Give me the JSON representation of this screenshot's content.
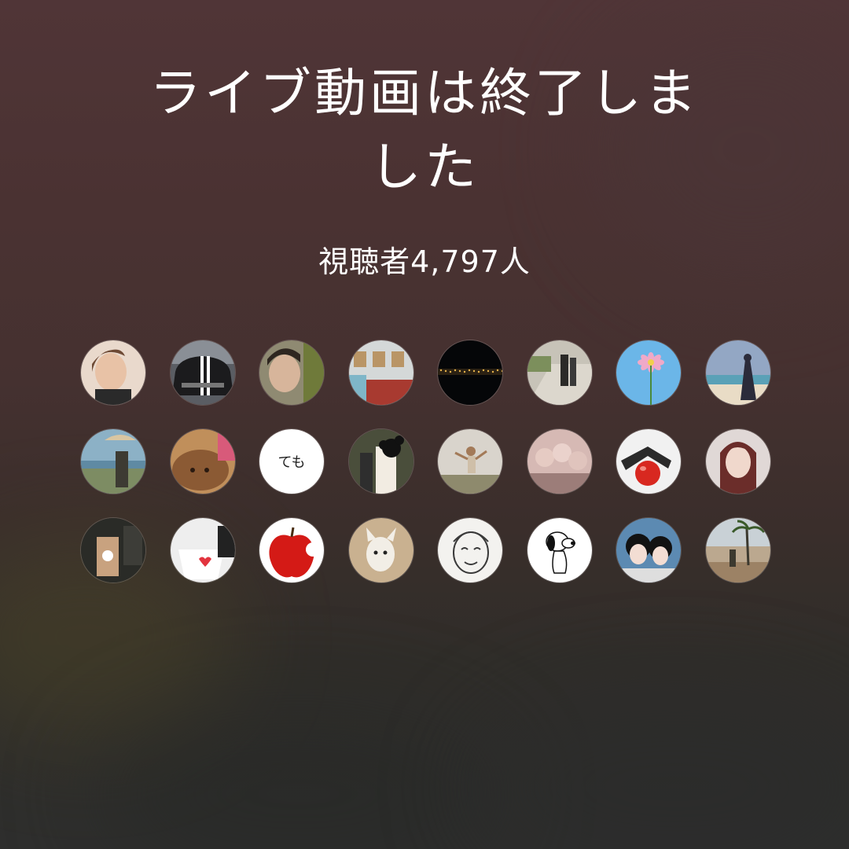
{
  "live": {
    "ended_title_line1": "ライブ動画は終了しま",
    "ended_title_line2": "した",
    "viewers_label": "視聴者4,797人"
  },
  "viewers": [
    {
      "icon": "woman-portrait",
      "colors": [
        "#e9d9cc",
        "#6e4a35"
      ]
    },
    {
      "icon": "black-car",
      "colors": [
        "#5a5d63",
        "#1b1b1d"
      ]
    },
    {
      "icon": "woman-selfie",
      "colors": [
        "#8f8a72",
        "#d7b59b"
      ]
    },
    {
      "icon": "cafe-interior",
      "colors": [
        "#d4d8d8",
        "#a83a30"
      ]
    },
    {
      "icon": "night-city",
      "colors": [
        "#050608",
        "#e7b24a"
      ]
    },
    {
      "icon": "couple-walkway",
      "colors": [
        "#c7c3b8",
        "#2b2a28"
      ]
    },
    {
      "icon": "pink-flower-sky",
      "colors": [
        "#6bb6e8",
        "#f0a9c8"
      ]
    },
    {
      "icon": "beach-woman",
      "colors": [
        "#93a7c4",
        "#e9dcc6"
      ]
    },
    {
      "icon": "seaside-umbrella",
      "colors": [
        "#8cb1c6",
        "#3d3b33"
      ]
    },
    {
      "icon": "poodle-dog",
      "colors": [
        "#c08f5b",
        "#8b5a34"
      ]
    },
    {
      "icon": "text-temo",
      "text": "ても",
      "colors": [
        "#ffffff",
        "#222222"
      ]
    },
    {
      "icon": "woman-character",
      "colors": [
        "#4a4e3b",
        "#f2ece2"
      ]
    },
    {
      "icon": "woman-jumping",
      "colors": [
        "#d9d4cc",
        "#8e8a6d"
      ]
    },
    {
      "icon": "friends-group",
      "colors": [
        "#d6b9b4",
        "#9c7d79"
      ]
    },
    {
      "icon": "red-ball",
      "colors": [
        "#f1f1f1",
        "#d82820"
      ]
    },
    {
      "icon": "woman-red-hair",
      "colors": [
        "#e0d8d6",
        "#6b2d2a"
      ]
    },
    {
      "icon": "cafe-drink",
      "colors": [
        "#2a2b27",
        "#c8a27f"
      ]
    },
    {
      "icon": "white-cup",
      "colors": [
        "#eeeeee",
        "#e2343f"
      ]
    },
    {
      "icon": "red-apple",
      "colors": [
        "#ffffff",
        "#d41a16"
      ]
    },
    {
      "icon": "white-dog",
      "colors": [
        "#c9b190",
        "#f2eee6"
      ]
    },
    {
      "icon": "sketch-face",
      "colors": [
        "#f3f2ef",
        "#3a3a3a"
      ]
    },
    {
      "icon": "snoopy",
      "colors": [
        "#ffffff",
        "#111111"
      ]
    },
    {
      "icon": "two-girls-selfie",
      "colors": [
        "#5c8ab2",
        "#121212"
      ]
    },
    {
      "icon": "palm-tree-man",
      "colors": [
        "#bba88f",
        "#3c392f"
      ]
    }
  ]
}
